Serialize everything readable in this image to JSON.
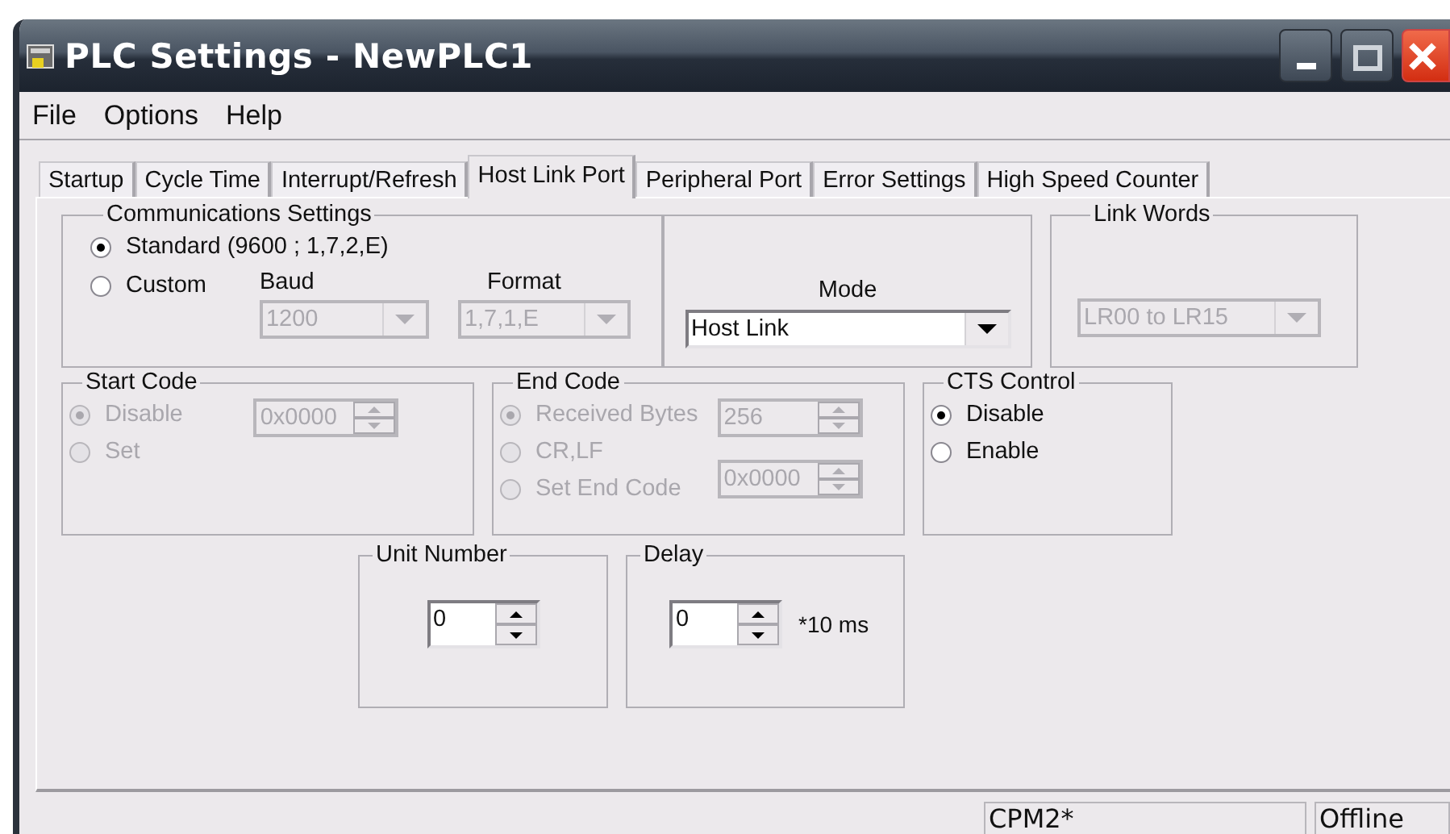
{
  "window": {
    "title": "PLC Settings - NewPLC1"
  },
  "menu": [
    {
      "label": "File"
    },
    {
      "label": "Options"
    },
    {
      "label": "Help"
    }
  ],
  "tabs": [
    {
      "label": "Startup",
      "selected": false
    },
    {
      "label": "Cycle Time",
      "selected": false
    },
    {
      "label": "Interrupt/Refresh",
      "selected": false
    },
    {
      "label": "Host Link Port",
      "selected": true
    },
    {
      "label": "Peripheral Port",
      "selected": false
    },
    {
      "label": "Error Settings",
      "selected": false
    },
    {
      "label": "High Speed Counter",
      "selected": false
    }
  ],
  "communications": {
    "title": "Communications Settings",
    "options": [
      {
        "label": "Standard (9600 ; 1,7,2,E)",
        "checked": true,
        "disabled": false
      },
      {
        "label": "Custom",
        "checked": false,
        "disabled": false
      }
    ],
    "baud": {
      "label": "Baud",
      "value": "1200",
      "disabled": true
    },
    "format": {
      "label": "Format",
      "value": "1,7,1,E",
      "disabled": true
    }
  },
  "mode": {
    "label": "Mode",
    "value": "Host Link",
    "disabled": false
  },
  "link_words": {
    "title": "Link Words",
    "value": "LR00 to LR15",
    "disabled": true
  },
  "start_code": {
    "title": "Start Code",
    "options": [
      {
        "label": "Disable",
        "checked": true,
        "disabled": true
      },
      {
        "label": "Set",
        "checked": false,
        "disabled": true
      }
    ],
    "code": {
      "value": "0x0000",
      "disabled": true
    }
  },
  "end_code": {
    "title": "End Code",
    "options": [
      {
        "label": "Received Bytes",
        "checked": true,
        "disabled": true
      },
      {
        "label": "CR,LF",
        "checked": false,
        "disabled": true
      },
      {
        "label": "Set End Code",
        "checked": false,
        "disabled": true
      }
    ],
    "received_bytes": {
      "value": "256",
      "disabled": true
    },
    "code": {
      "value": "0x0000",
      "disabled": true
    }
  },
  "cts_control": {
    "title": "CTS Control",
    "options": [
      {
        "label": "Disable",
        "checked": true,
        "disabled": false
      },
      {
        "label": "Enable",
        "checked": false,
        "disabled": false
      }
    ]
  },
  "unit_number": {
    "title": "Unit Number",
    "value": "0",
    "disabled": false
  },
  "delay": {
    "title": "Delay",
    "value": "0",
    "disabled": false,
    "unit": "*10 ms"
  },
  "status_bar": [
    "CPM2*",
    "Offline"
  ]
}
